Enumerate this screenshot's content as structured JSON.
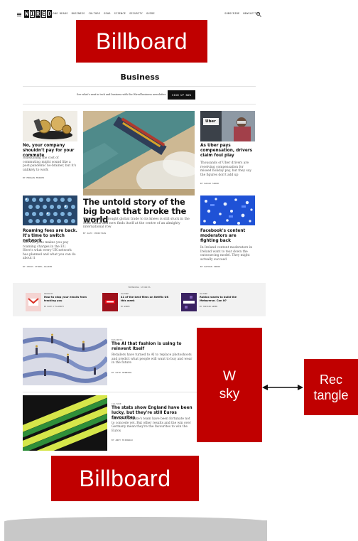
{
  "nav": {
    "links": [
      "LONG READS",
      "BUSINESS",
      "CULTURE",
      "GEAR",
      "SCIENCE",
      "SECURITY",
      "GUIDE"
    ],
    "right_links": [
      "SUBSCRIBE",
      "NEWSLETTER"
    ],
    "logo_letters": [
      "W",
      "I",
      "R",
      "E",
      "D"
    ]
  },
  "ads": {
    "billboard_top": "Billboard",
    "wsky_line1": "W",
    "wsky_line2": "sky",
    "rect_line1": "Rec",
    "rect_line2": "tangle",
    "billboard_bottom": "Billboard"
  },
  "section": {
    "title": "Business",
    "newsletter_text": "See what's next in tech and business with the Wired business newsletter",
    "signup_label": "SIGN UP NOW"
  },
  "stories": {
    "commute": {
      "title": "No, your company shouldn't pay for your commute",
      "dek": "Subsidising the cost of commuting might sound like a post-pandemic no-brainer, but it's unlikely to work",
      "byline": "BY MORGAN MEAKER"
    },
    "roaming": {
      "title": "Roaming fees are back. It's time to switch network",
      "dek": "Not everyone makes you pay roaming charges in the EU. Here's what every UK network has planned and what you can do about it",
      "byline": "BY CHRIS STOKEL-WALKER"
    },
    "ship": {
      "title": "The untold story of the big boat that broke the world",
      "dek": "The ship that brought global trade to its knees is still stuck in the Suez Canal and new finds itself at the centre of an almighty international row",
      "byline": "BY ALEX CHRISTIAN"
    },
    "uber": {
      "title": "As Uber pays compensation, drivers claim foul play",
      "dek": "Thousands of Uber drivers are receiving compensation for missed holiday pay, but they say the figures don't add up",
      "byline": "BY NAVAR SNOOK",
      "image_text": "Uber"
    },
    "facebook": {
      "title": "Facebook's content moderators are fighting back",
      "dek": "In Ireland content moderators in Ireland want to tear down the outsourcing model. They might actually succeed",
      "byline": "BY NATHAN SNOOK"
    },
    "fashion": {
      "rubric": "BUSINESS",
      "title": "The AI that fashion is using to reinvent itself",
      "dek": "Retailers have turned to AI to replace photoshoots and predict what people will want to buy and wear in the future",
      "byline": "BY KATE HENRSON"
    },
    "euros": {
      "rubric": "CULTURE",
      "title": "The stats show England have been lucky, but they're still Euros favourites",
      "dek": "Gareth Southgate's team have been fortunate not to concede yet. But other results and the win over Germany mean they're the favourites to win the Euros",
      "byline": "BY ANDY McDONALD"
    }
  },
  "trending": {
    "label": "TRENDING STORIES",
    "items": [
      {
        "rubric": "SECURITY",
        "title": "How to stop your emails from tracking you",
        "byline": "BY KATE O'FLAHERTY"
      },
      {
        "rubric": "CULTURE",
        "title": "41 of the best films on Netflix UK this week",
        "byline": "BY WIRED"
      },
      {
        "rubric": "CULTURE",
        "title": "Roblox wants to build the Metaverse. Can it?",
        "byline": "BY TRISTAN GREEN"
      }
    ]
  },
  "colors": {
    "ad_red": "#c00000",
    "signup_bg": "#111111",
    "trending_bg": "#f2f2f2"
  }
}
